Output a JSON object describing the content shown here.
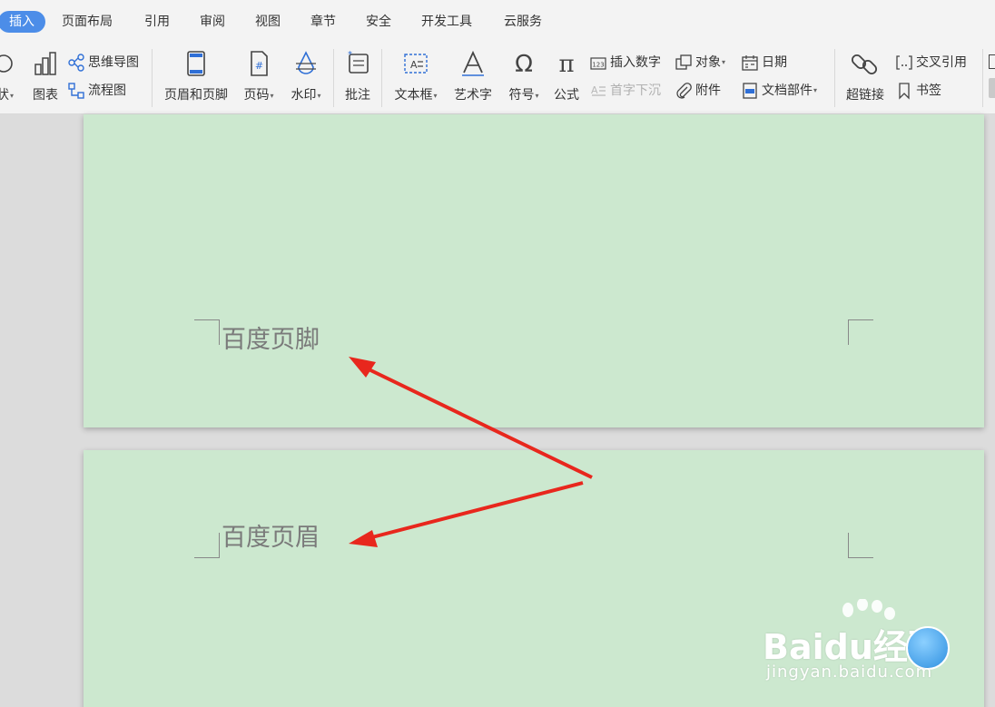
{
  "menu": {
    "tabs": [
      "插入",
      "页面布局",
      "引用",
      "审阅",
      "视图",
      "章节",
      "安全",
      "开发工具",
      "云服务"
    ]
  },
  "ribbon": {
    "shape_label": "状",
    "chart_label": "图表",
    "mindmap_label": "思维导图",
    "flowchart_label": "流程图",
    "header_footer_label": "页眉和页脚",
    "page_number_label": "页码",
    "watermark_label": "水印",
    "comment_label": "批注",
    "textbox_label": "文本框",
    "wordart_label": "艺术字",
    "symbol_label": "符号",
    "equation_label": "公式",
    "insert_number_label": "插入数字",
    "drop_cap_label": "首字下沉",
    "object_label": "对象",
    "attachment_label": "附件",
    "date_label": "日期",
    "doc_parts_label": "文档部件",
    "hyperlink_label": "超链接",
    "cross_reference_label": "交叉引用",
    "bookmark_label": "书签"
  },
  "document": {
    "page1_footer_text": "百度页脚",
    "page2_header_text": "百度页眉"
  },
  "watermark": {
    "logo": "Baidu经验",
    "site": "jingyan.baidu.com"
  },
  "colors": {
    "active_tab": "#4c8de8",
    "page_background": "#cce8cf",
    "arrow": "#e8271d"
  }
}
